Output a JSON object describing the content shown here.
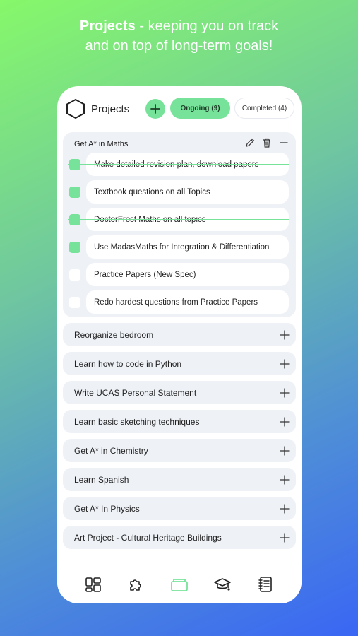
{
  "headline": {
    "bold": "Projects",
    "rest": " - keeping you on track",
    "line2": "and on top of long-term goals!"
  },
  "app": {
    "title": "Projects",
    "tabs": {
      "ongoing": "Ongoing (9)",
      "completed": "Completed (4)"
    }
  },
  "colors": {
    "accent": "#77e39a",
    "card": "#eef1f6"
  },
  "expanded_project": {
    "title": "Get A* in Maths",
    "tasks": [
      {
        "label": "Make detailed revision plan, download papers",
        "done": true
      },
      {
        "label": "Textbook questions on all Topics",
        "done": true
      },
      {
        "label": "DoctorFrost Maths on all topics",
        "done": true
      },
      {
        "label": "Use MadasMaths for Integration & Differentiation",
        "done": true
      },
      {
        "label": "Practice Papers (New Spec)",
        "done": false
      },
      {
        "label": "Redo hardest questions from Practice Papers",
        "done": false
      }
    ]
  },
  "projects": [
    "Reorganize bedroom",
    "Learn how to code in Python",
    "Write UCAS Personal Statement",
    "Learn basic sketching techniques",
    "Get A* in Chemistry",
    "Learn Spanish",
    "Get A* In Physics",
    "Art Project - Cultural Heritage Buildings"
  ],
  "nav": [
    "dashboard-icon",
    "puzzle-icon",
    "folder-icon",
    "graduation-cap-icon",
    "notebook-icon"
  ]
}
